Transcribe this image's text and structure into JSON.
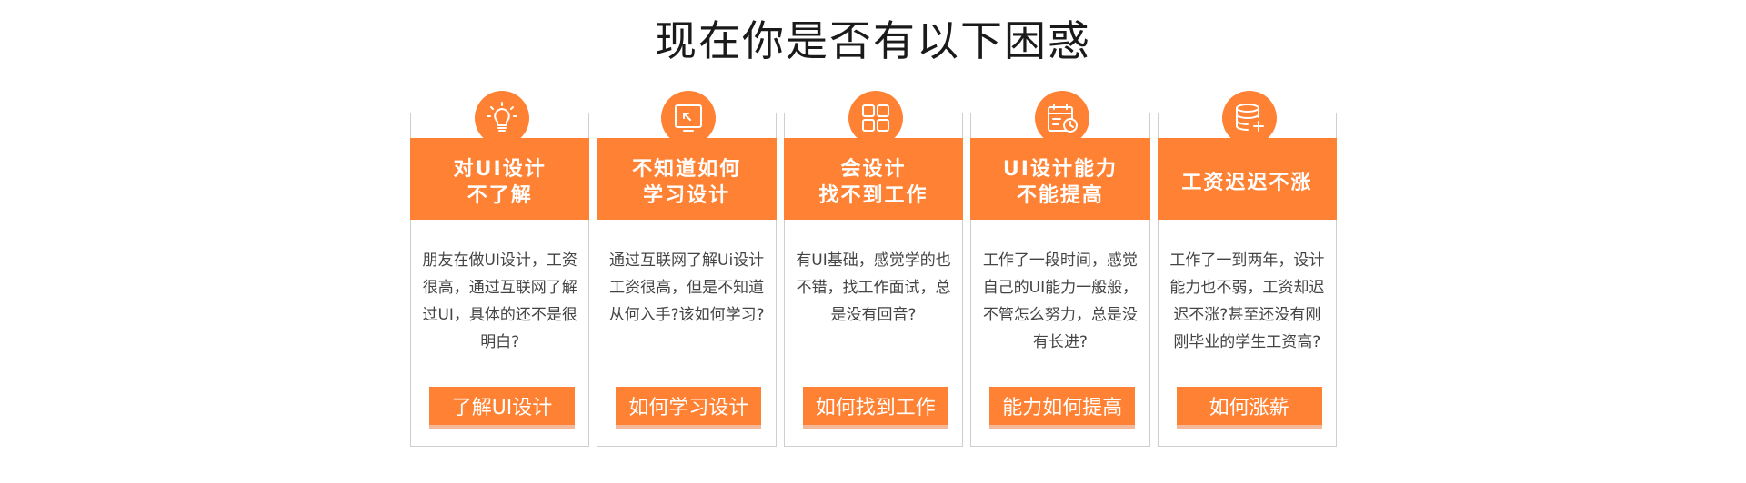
{
  "title": "现在你是否有以下困惑",
  "accent_color": "#ff8234",
  "cards": [
    {
      "icon": "lightbulb-icon",
      "header": "对UI设计\n不了解",
      "body": "朋友在做UI设计，工资很高，通过互联网了解过UI，具体的还不是很明白?",
      "button": "了解UI设计"
    },
    {
      "icon": "monitor-cursor-icon",
      "header": "不知道如何\n学习设计",
      "body": "通过互联网了解Ui设计工资很高，但是不知道从何入手?该如何学习?",
      "button": "如何学习设计"
    },
    {
      "icon": "grid-icon",
      "header": "会设计\n找不到工作",
      "body": "有UI基础，感觉学的也不错，找工作面试，总是没有回音?",
      "button": "如何找到工作"
    },
    {
      "icon": "calendar-clock-icon",
      "header": "UI设计能力\n不能提高",
      "body": "工作了一段时间，感觉自己的UI能力一般般，不管怎么努力，总是没有长进?",
      "button": "能力如何提高"
    },
    {
      "icon": "database-plus-icon",
      "header": "工资迟迟不涨",
      "body": "工作了一到两年，设计能力也不弱，工资却迟迟不涨?甚至还没有刚刚毕业的学生工资高?",
      "button": "如何涨薪"
    }
  ]
}
